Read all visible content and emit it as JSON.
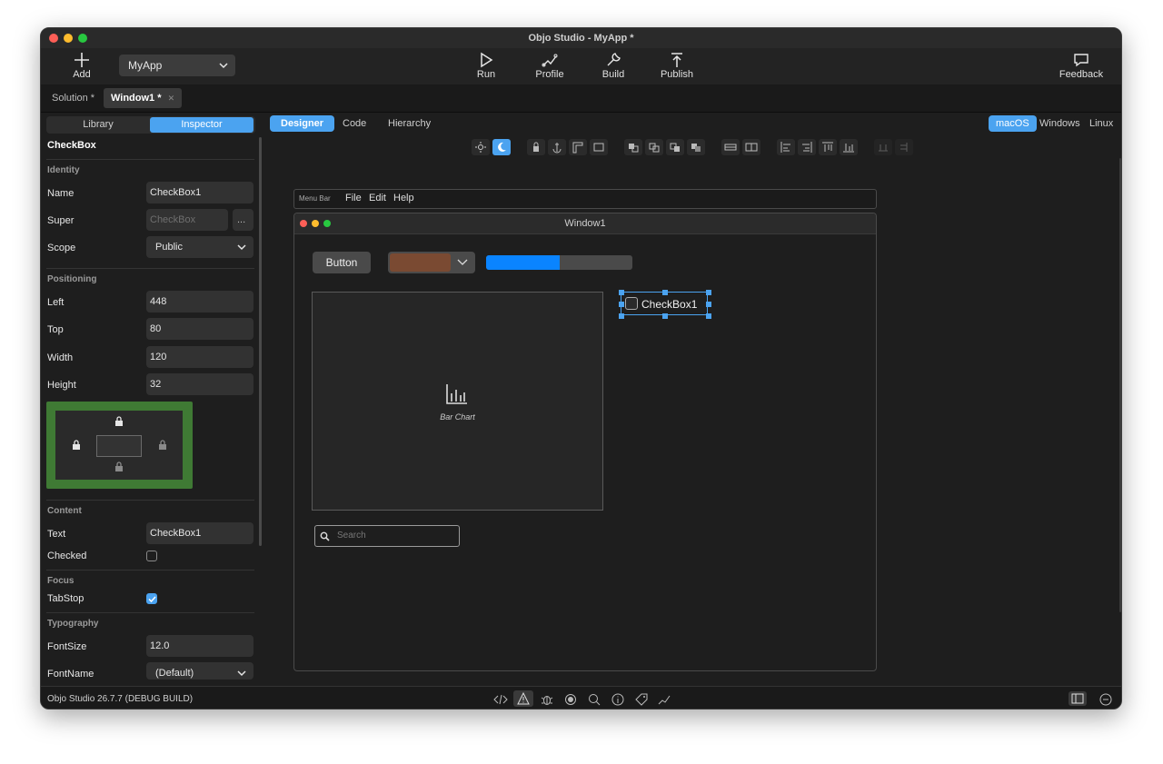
{
  "window": {
    "title": "Objo Studio - MyApp *"
  },
  "toolbar": {
    "add_label": "Add",
    "project_select": "MyApp",
    "run_label": "Run",
    "profile_label": "Profile",
    "build_label": "Build",
    "publish_label": "Publish",
    "feedback_label": "Feedback"
  },
  "doc_tabs": [
    {
      "label": "Solution *"
    },
    {
      "label": "Window1 *"
    }
  ],
  "left_panel": {
    "tabs": {
      "library": "Library",
      "inspector": "Inspector"
    },
    "object_title": "CheckBox",
    "identity": {
      "heading": "Identity",
      "name_label": "Name",
      "name_value": "CheckBox1",
      "super_label": "Super",
      "super_placeholder": "CheckBox",
      "super_button": "...",
      "scope_label": "Scope",
      "scope_value": "Public"
    },
    "positioning": {
      "heading": "Positioning",
      "left_label": "Left",
      "left_value": "448",
      "top_label": "Top",
      "top_value": "80",
      "width_label": "Width",
      "width_value": "120",
      "height_label": "Height",
      "height_value": "32"
    },
    "content": {
      "heading": "Content",
      "text_label": "Text",
      "text_value": "CheckBox1",
      "checked_label": "Checked",
      "checked": false
    },
    "focus": {
      "heading": "Focus",
      "tabstop_label": "TabStop",
      "tabstop": true
    },
    "typography": {
      "heading": "Typography",
      "fontsize_label": "FontSize",
      "fontsize_value": "12.0",
      "fontname_label": "FontName",
      "fontname_value": "(Default)"
    }
  },
  "right_panel": {
    "tabs": {
      "designer": "Designer",
      "code": "Code",
      "hierarchy": "Hierarchy"
    },
    "platforms": {
      "macos": "macOS",
      "windows": "Windows",
      "linux": "Linux"
    }
  },
  "canvas": {
    "menubar_label": "Menu Bar",
    "menus": [
      "File",
      "Edit",
      "Help"
    ],
    "window_title": "Window1",
    "button_label": "Button",
    "progress_fraction": 0.5,
    "chart_placeholder": "Bar Chart",
    "checkbox_label": "CheckBox1",
    "search_placeholder": "Search"
  },
  "status": {
    "text": "Objo Studio 26.7.7 (DEBUG BUILD)"
  },
  "colors": {
    "accent": "#4ba3f0",
    "popup_swatch": "#7a4a32",
    "progress_fill": "#0a84ff",
    "anchor_panel": "#3f7a34"
  }
}
